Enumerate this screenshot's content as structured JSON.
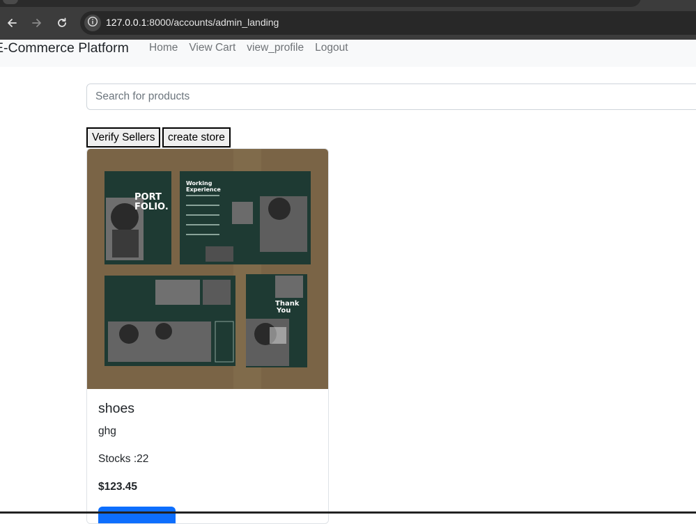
{
  "browser": {
    "url_host": "127.0.0.1",
    "url_path": ":8000/accounts/admin_landing",
    "back_icon": "arrow-left-icon",
    "forward_icon": "arrow-right-icon",
    "reload_icon": "reload-icon",
    "site_info_icon": "info-icon"
  },
  "navbar": {
    "brand": "E-Commerce Platform",
    "links": [
      "Home",
      "View Cart",
      "view_profile",
      "Logout"
    ]
  },
  "search": {
    "placeholder": "Search for products",
    "value": ""
  },
  "actions": {
    "verify_sellers": "Verify Sellers",
    "create_store": "create store"
  },
  "product": {
    "title": "shoes",
    "description": "ghg",
    "stock": "Stocks :22",
    "price": "$123.45",
    "image_texts": [
      "PORT",
      "FOLIO.",
      "Working",
      "Experience",
      "Thank",
      "You"
    ]
  },
  "colors": {
    "browser_bg": "#3c3c3c",
    "url_bg": "#282828",
    "navbar_bg": "#f8f9fa",
    "primary": "#0d6efd",
    "image_bg": "#7a6446",
    "image_panel": "#1e3a33"
  }
}
